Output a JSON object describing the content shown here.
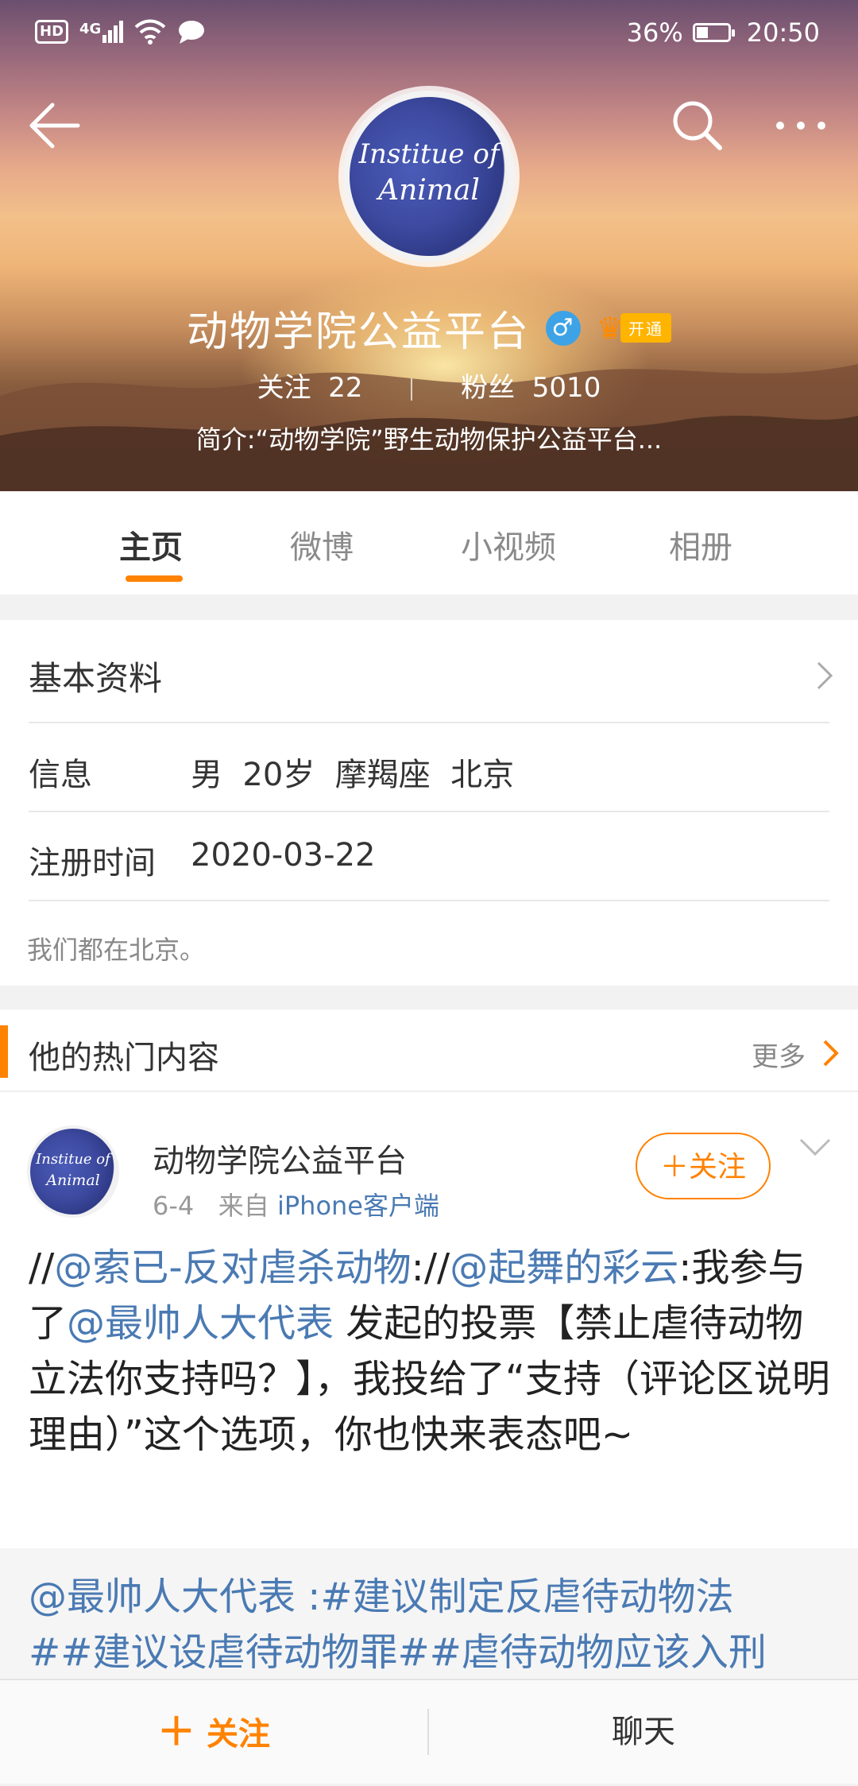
{
  "status_bar": {
    "left_badge": "HD",
    "network": "4G",
    "battery": "36%",
    "battery_level": 0.36,
    "time": "20:50"
  },
  "header": {
    "avatar_text_line1": "Institue of",
    "avatar_text_line2": "Animal",
    "name": "动物学院公益平台",
    "gender_symbol": "♂",
    "vip_label": "开通",
    "following_label": "关注",
    "following_count": "22",
    "followers_label": "粉丝",
    "followers_count": "5010",
    "bio": "简介:“动物学院”野生动物保护公益平台..."
  },
  "tabs": [
    {
      "label": "主页"
    },
    {
      "label": "微博"
    },
    {
      "label": "小视频"
    },
    {
      "label": "相册"
    }
  ],
  "basic_info": {
    "title": "基本资料",
    "info_label": "信息",
    "info_value": "男  20岁  摩羯座  北京",
    "register_label": "注册时间",
    "register_value": "2020-03-22",
    "note": "我们都在北京。"
  },
  "hot": {
    "title": "他的热门内容",
    "more_label": "更多",
    "post": {
      "author": "动物学院公益平台",
      "date": "6-4",
      "from_label": "来自",
      "source": "iPhone客户端",
      "follow_label": "＋关注",
      "segments": [
        {
          "text": "//",
          "mention": false
        },
        {
          "text": "@索已-反对虐杀动物",
          "mention": true
        },
        {
          "text": "://",
          "mention": false
        },
        {
          "text": "@起舞的彩云",
          "mention": true
        },
        {
          "text": ":我参与了",
          "mention": false
        },
        {
          "text": "@最帅人大代表",
          "mention": true
        },
        {
          "text": " 发起的投票【禁止虐待动物立法你支持吗？】，我投给了“支持（评论区说明理由）”这个选项，你也快来表态吧~",
          "mention": false
        }
      ],
      "quote_line1": "@最帅人大代表 :#建议制定反虐待动物法",
      "quote_line2": "##建议设虐待动物罪##虐待动物应该入刑"
    }
  },
  "bottom_bar": {
    "follow_label": "关注",
    "chat_label": "聊天"
  },
  "colors": {
    "accent": "#ff8200",
    "link": "#4a7ab3",
    "gender_badge": "#3da3e6"
  }
}
